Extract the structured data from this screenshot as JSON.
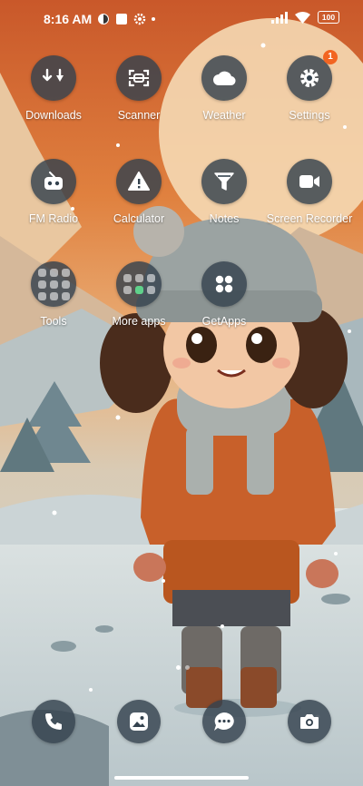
{
  "status_bar": {
    "time": "8:16 AM",
    "battery": "100"
  },
  "apps": [
    {
      "label": "Downloads",
      "icon": "download-icon"
    },
    {
      "label": "Scanner",
      "icon": "scanner-icon"
    },
    {
      "label": "Weather",
      "icon": "cloud-icon"
    },
    {
      "label": "Settings",
      "icon": "gear-icon",
      "badge": "1"
    },
    {
      "label": "FM Radio",
      "icon": "radio-icon"
    },
    {
      "label": "Calculator",
      "icon": "calculator-icon"
    },
    {
      "label": "Notes",
      "icon": "notes-icon"
    },
    {
      "label": "Screen Recorder",
      "icon": "video-camera-icon"
    },
    {
      "label": "Tools",
      "icon": "folder-icon"
    },
    {
      "label": "More apps",
      "icon": "folder-icon"
    },
    {
      "label": "GetApps",
      "icon": "app-store-icon"
    }
  ],
  "dock": [
    {
      "icon": "phone-icon"
    },
    {
      "icon": "gallery-icon"
    },
    {
      "icon": "messages-icon"
    },
    {
      "icon": "camera-icon"
    }
  ],
  "colors": {
    "icon_bg": "#34424e",
    "badge": "#f26522",
    "sky": "#e07a3a"
  }
}
